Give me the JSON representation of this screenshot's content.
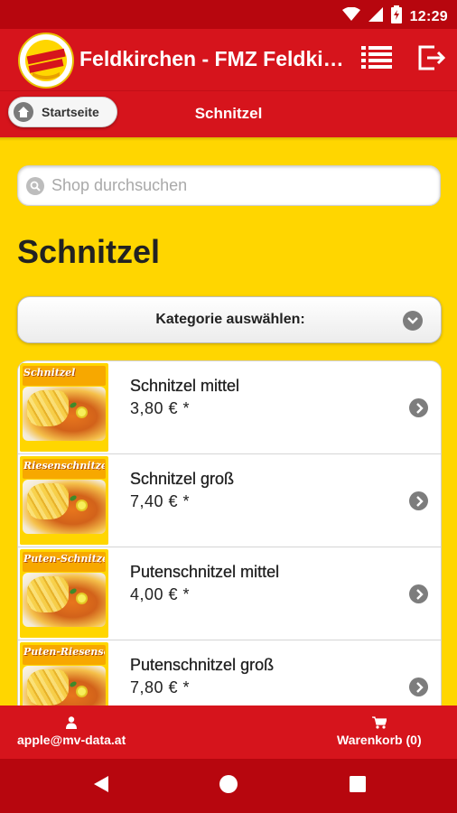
{
  "status_bar": {
    "time": "12:29"
  },
  "app_bar": {
    "title": "Feldkirchen - FMZ Feldkirchen"
  },
  "sub_header": {
    "home_label": "Startseite",
    "title": "Schnitzel"
  },
  "search": {
    "placeholder": "Shop durchsuchen",
    "value": ""
  },
  "page": {
    "heading": "Schnitzel"
  },
  "category_select": {
    "label": "Kategorie auswählen:"
  },
  "products": [
    {
      "name": "Schnitzel mittel",
      "price": "3,80 € *",
      "image_label": "Schnitzel"
    },
    {
      "name": "Schnitzel groß",
      "price": "7,40 € *",
      "image_label": "Riesenschnitzel"
    },
    {
      "name": "Putenschnitzel mittel",
      "price": "4,00 € *",
      "image_label": "Puten-Schnitzel"
    },
    {
      "name": "Putenschnitzel groß",
      "price": "7,80 € *",
      "image_label": "Puten-Riesenschnitzel"
    }
  ],
  "bottom_bar": {
    "account": "apple@mv-data.at",
    "cart": "Warenkorb (0)"
  },
  "colors": {
    "brand_red": "#d6141c",
    "brand_yellow": "#ffd600",
    "status_red": "#b7060e"
  },
  "icons": [
    "wifi-icon",
    "signal-icon",
    "battery-icon",
    "list-icon",
    "logout-icon",
    "home-icon",
    "search-icon",
    "chevron-down-icon",
    "chevron-right-icon",
    "user-icon",
    "cart-icon",
    "back-icon",
    "home-nav-icon",
    "recents-icon"
  ]
}
